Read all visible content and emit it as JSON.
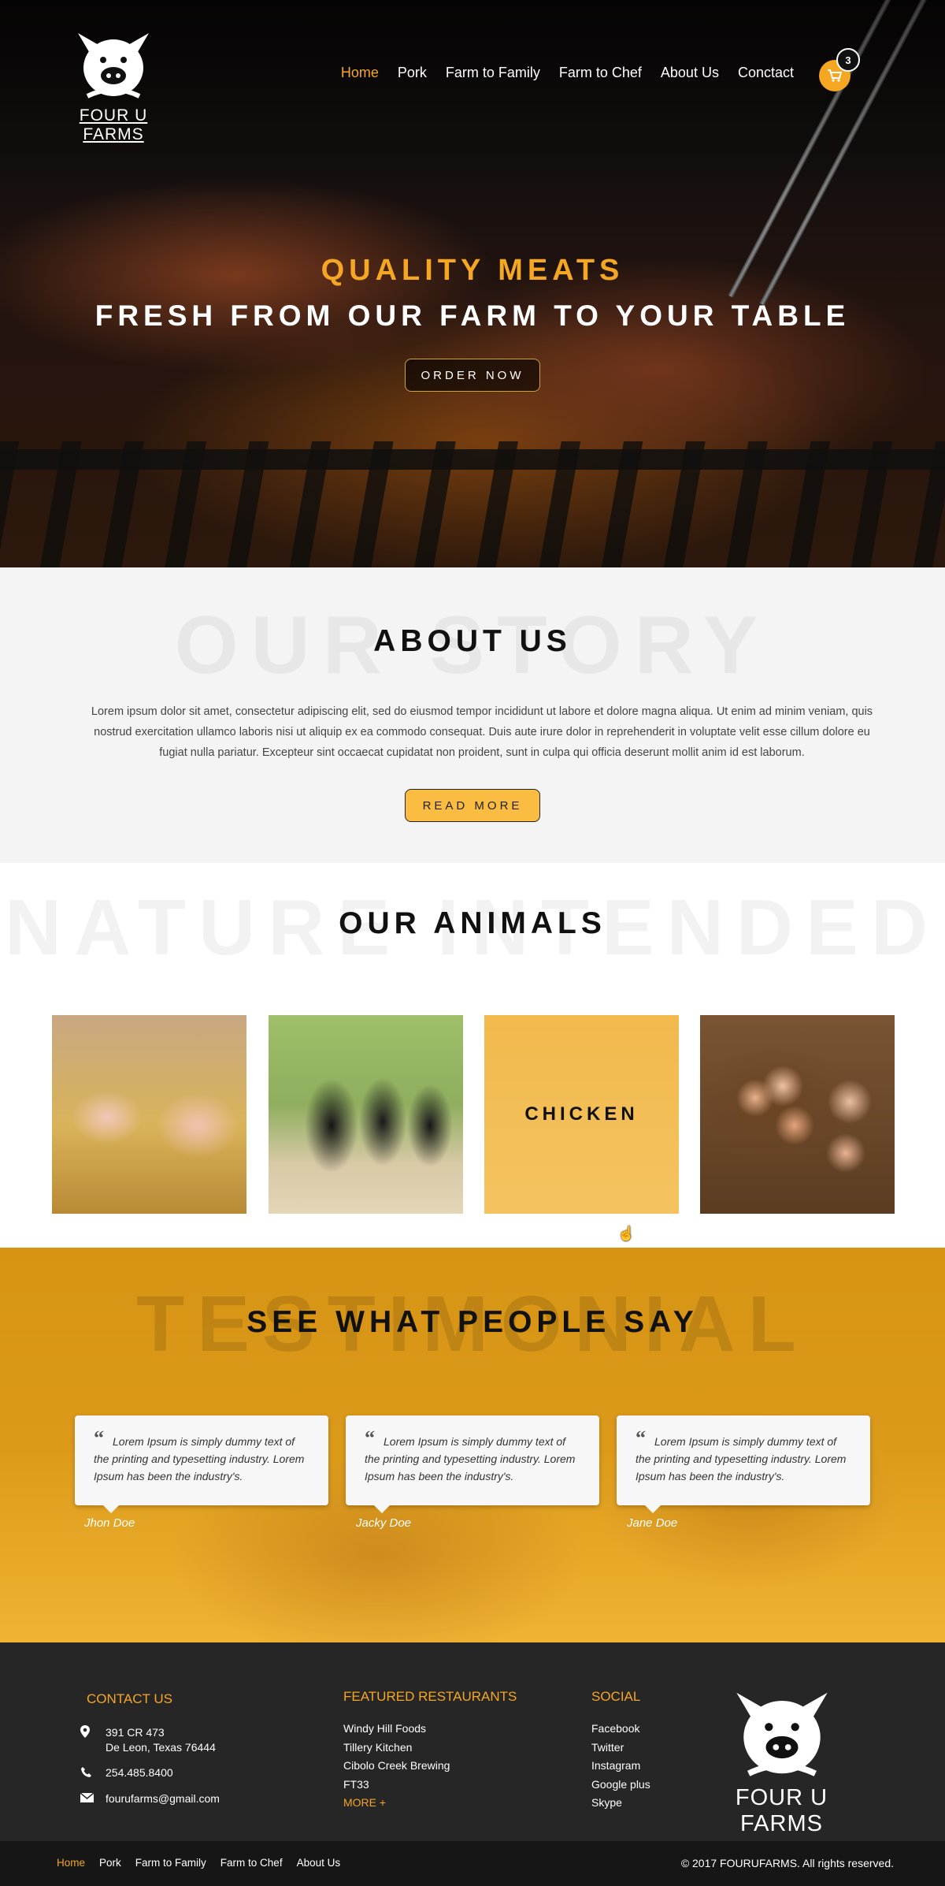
{
  "brand": {
    "name": "FOUR U FARMS",
    "logo_icon": "pig-logo-icon"
  },
  "nav": {
    "items": [
      {
        "label": "Home",
        "active": true
      },
      {
        "label": "Pork"
      },
      {
        "label": "Farm to Family"
      },
      {
        "label": "Farm to Chef"
      },
      {
        "label": "About Us"
      },
      {
        "label": "Conctact"
      }
    ],
    "cart_count": "3"
  },
  "hero": {
    "kicker": "QUALITY MEATS",
    "title": "FRESH FROM OUR FARM TO YOUR TABLE",
    "button": "ORDER NOW"
  },
  "about": {
    "bg_word": "OUR STORY",
    "title": "ABOUT US",
    "text": "Lorem ipsum dolor sit amet, consectetur adipiscing elit, sed do eiusmod tempor incididunt ut labore et dolore magna aliqua. Ut enim ad minim veniam, quis nostrud exercitation ullamco laboris nisi ut aliquip ex ea commodo consequat. Duis aute irure dolor in reprehenderit in voluptate velit esse cillum dolore eu fugiat nulla pariatur. Excepteur sint occaecat cupidatat non proident, sunt in culpa qui officia deserunt mollit anim id est laborum.",
    "button": "READ MORE"
  },
  "animals": {
    "bg_word": "NATURE INTENDED",
    "title": "OUR ANIMALS",
    "cards": [
      {
        "image": "pigs-photo"
      },
      {
        "image": "cattle-photo"
      },
      {
        "image": "chickens-photo",
        "label": "CHICKEN"
      },
      {
        "image": "eggs-photo"
      }
    ]
  },
  "testimonials": {
    "bg_word": "TESTIMONIAL",
    "title": "SEE WHAT PEOPLE SAY",
    "items": [
      {
        "quote": "Lorem Ipsum is simply dummy text of the printing and typesetting industry. Lorem Ipsum has been the industry's.",
        "author": "Jhon Doe"
      },
      {
        "quote": "Lorem Ipsum is simply dummy text of the printing and typesetting industry. Lorem Ipsum has been the industry's.",
        "author": "Jacky Doe"
      },
      {
        "quote": "Lorem Ipsum is simply dummy text of the printing and typesetting industry. Lorem Ipsum has been the industry's.",
        "author": "Jane Doe"
      }
    ]
  },
  "footer": {
    "contact": {
      "heading": "CONTACT US",
      "address_line1": "391 CR 473",
      "address_line2": "De Leon, Texas 76444",
      "phone": "254.485.8400",
      "email": "fourufarms@gmail.com"
    },
    "restaurants": {
      "heading": "FEATURED RESTAURANTS",
      "items": [
        "Windy Hill Foods",
        "Tillery Kitchen",
        "Cibolo Creek Brewing",
        "FT33"
      ],
      "more": "MORE +"
    },
    "social": {
      "heading": "SOCIAL",
      "items": [
        "Facebook",
        "Twitter",
        "Instagram",
        "Google plus",
        "Skype"
      ]
    }
  },
  "bottom": {
    "nav": [
      {
        "label": "Home",
        "active": true
      },
      {
        "label": "Pork"
      },
      {
        "label": "Farm to Family"
      },
      {
        "label": "Farm to Chef"
      },
      {
        "label": "About Us"
      }
    ],
    "copyright": "© 2017 FOURUFARMS. All rights reserved."
  },
  "colors": {
    "accent": "#f5a623",
    "footer_bg": "#262626",
    "bottom_bg": "#161616",
    "testimonial_bg": "#d99a1c"
  }
}
